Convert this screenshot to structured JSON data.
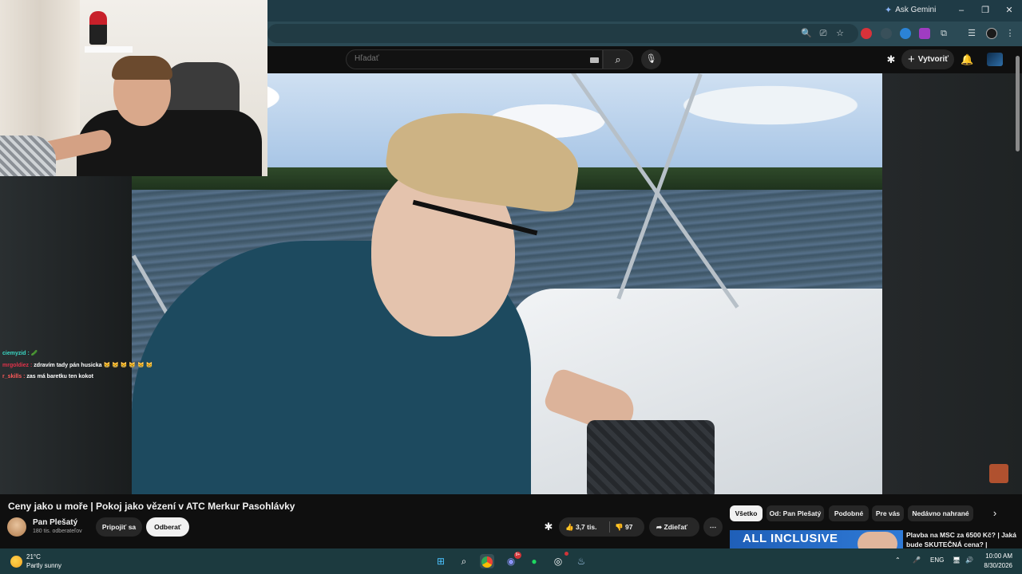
{
  "browser": {
    "ask_gemini": "Ask Gemini",
    "window_controls": [
      "–",
      "❐",
      "✕"
    ]
  },
  "youtube": {
    "search_placeholder": "Hľadať",
    "create_label": "Vytvoriť",
    "video_title": "Ceny jako u moře | Pokoj jako vězení v ATC Merkur Pasohlávky",
    "channel": {
      "name": "Pan Plešatý",
      "subscribers": "180 tis. odberateľov",
      "join_label": "Pripojiť sa",
      "subscribe_label": "Odberať"
    },
    "actions": {
      "likes": "3,7 tis.",
      "dislikes": "97",
      "share": "Zdieľať",
      "more": "⋯"
    },
    "chips": [
      "Všetko",
      "Od: Pan Plešatý",
      "Podobné",
      "Pre vás",
      "Nedávno nahrané"
    ],
    "recommendation": {
      "thumb_text": "ALL INCLUSIVE",
      "title": "Plavba na MSC za 6500 Kč? | Jaká bude SKUTEČNÁ cena? |"
    }
  },
  "chat": [
    {
      "user": "ciemyzid :",
      "message": "🥒",
      "color": "#3ad6c3"
    },
    {
      "user": "mrgoldiez :",
      "message": "zdravím tady pán husicka 😸 😸 😸 😸 😸 😸",
      "color": "#e0324a"
    },
    {
      "user": "r_skills :",
      "message": "zas má baretku ten kokot",
      "color": "#ff5a5a"
    }
  ],
  "taskbar": {
    "temperature": "21°C",
    "weather": "Partly sunny",
    "language": "ENG",
    "time": "10:00 AM",
    "date": "8/30/2026",
    "discord_badge": "9+"
  },
  "colors": {
    "titlebar": "#1f3b46",
    "taskbar": "#1c3a3f",
    "yt_bg": "#0f0f0f"
  }
}
